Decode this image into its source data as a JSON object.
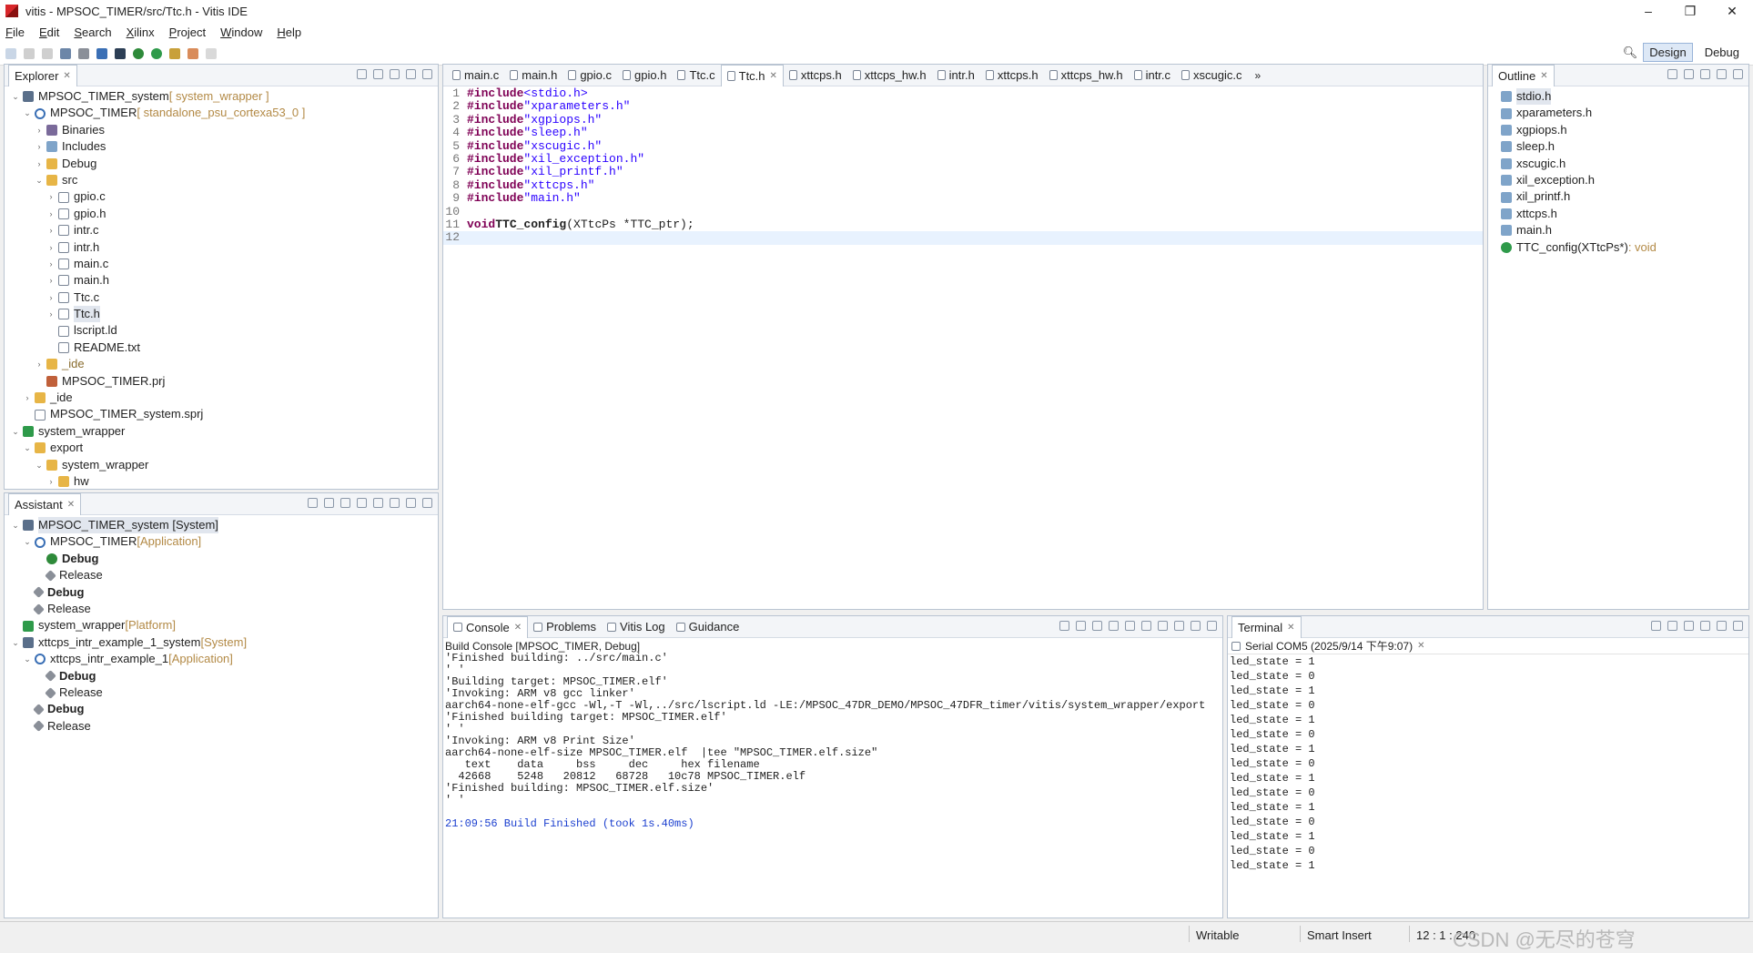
{
  "window": {
    "title": "vitis - MPSOC_TIMER/src/Ttc.h - Vitis IDE",
    "min": "–",
    "max": "❐",
    "close": "✕"
  },
  "menu": [
    "File",
    "Edit",
    "Search",
    "Xilinx",
    "Project",
    "Window",
    "Help"
  ],
  "perspectives": {
    "design": "Design",
    "debug": "Debug"
  },
  "explorer": {
    "tab": "Explorer",
    "rows": [
      {
        "text": "MPSOC_TIMER_system",
        "dec": " [ system_wrapper ]",
        "indent": 0,
        "tw": "⌄",
        "icon": "sys"
      },
      {
        "text": "MPSOC_TIMER",
        "dec": " [ standalone_psu_cortexa53_0 ]",
        "indent": 1,
        "tw": "⌄",
        "icon": "app"
      },
      {
        "text": "Binaries",
        "dec": "",
        "indent": 2,
        "tw": "›",
        "icon": "bin"
      },
      {
        "text": "Includes",
        "dec": "",
        "indent": 2,
        "tw": "›",
        "icon": "inc"
      },
      {
        "text": "Debug",
        "dec": "",
        "indent": 2,
        "tw": "›",
        "icon": "folder"
      },
      {
        "text": "src",
        "dec": "",
        "indent": 2,
        "tw": "⌄",
        "icon": "folder"
      },
      {
        "text": "gpio.c",
        "dec": "",
        "indent": 3,
        "tw": "›",
        "icon": "file"
      },
      {
        "text": "gpio.h",
        "dec": "",
        "indent": 3,
        "tw": "›",
        "icon": "file"
      },
      {
        "text": "intr.c",
        "dec": "",
        "indent": 3,
        "tw": "›",
        "icon": "file"
      },
      {
        "text": "intr.h",
        "dec": "",
        "indent": 3,
        "tw": "›",
        "icon": "file"
      },
      {
        "text": "main.c",
        "dec": "",
        "indent": 3,
        "tw": "›",
        "icon": "file"
      },
      {
        "text": "main.h",
        "dec": "",
        "indent": 3,
        "tw": "›",
        "icon": "file"
      },
      {
        "text": "Ttc.c",
        "dec": "",
        "indent": 3,
        "tw": "›",
        "icon": "file"
      },
      {
        "text": "Ttc.h",
        "dec": "",
        "indent": 3,
        "tw": "›",
        "icon": "file",
        "sel": true
      },
      {
        "text": "lscript.ld",
        "dec": "",
        "indent": 3,
        "tw": "",
        "icon": "file"
      },
      {
        "text": "README.txt",
        "dec": "",
        "indent": 3,
        "tw": "",
        "icon": "file"
      },
      {
        "text": "_ide",
        "dec": "",
        "indent": 2,
        "tw": "›",
        "icon": "folder",
        "dim": true
      },
      {
        "text": "MPSOC_TIMER.prj",
        "dec": "",
        "indent": 2,
        "tw": "",
        "icon": "cfg"
      },
      {
        "text": "_ide",
        "dec": "",
        "indent": 1,
        "tw": "›",
        "icon": "folder"
      },
      {
        "text": "MPSOC_TIMER_system.sprj",
        "dec": "",
        "indent": 1,
        "tw": "",
        "icon": "file"
      },
      {
        "text": "system_wrapper",
        "dec": "",
        "indent": 0,
        "tw": "⌄",
        "icon": "plat"
      },
      {
        "text": "export",
        "dec": "",
        "indent": 1,
        "tw": "⌄",
        "icon": "folder"
      },
      {
        "text": "system_wrapper",
        "dec": "",
        "indent": 2,
        "tw": "⌄",
        "icon": "folder"
      },
      {
        "text": "hw",
        "dec": "",
        "indent": 3,
        "tw": "›",
        "icon": "folder"
      }
    ]
  },
  "assistant": {
    "tab": "Assistant",
    "rows": [
      {
        "text": "MPSOC_TIMER_system [System]",
        "dec": "",
        "indent": 0,
        "tw": "⌄",
        "icon": "sys",
        "sel": true
      },
      {
        "text": "MPSOC_TIMER",
        "dec": " [Application]",
        "indent": 1,
        "tw": "⌄",
        "icon": "app"
      },
      {
        "text": "Debug",
        "dec": "",
        "indent": 2,
        "tw": "",
        "icon": "bug",
        "bold": true
      },
      {
        "text": "Release",
        "dec": "",
        "indent": 2,
        "tw": "",
        "icon": "hammer"
      },
      {
        "text": "Debug",
        "dec": "",
        "indent": 1,
        "tw": "",
        "icon": "hammer",
        "bold": true
      },
      {
        "text": "Release",
        "dec": "",
        "indent": 1,
        "tw": "",
        "icon": "hammer"
      },
      {
        "text": "system_wrapper",
        "dec": " [Platform]",
        "indent": 0,
        "tw": "",
        "icon": "plat"
      },
      {
        "text": "xttcps_intr_example_1_system",
        "dec": " [System]",
        "indent": 0,
        "tw": "⌄",
        "icon": "sys"
      },
      {
        "text": "xttcps_intr_example_1",
        "dec": " [Application]",
        "indent": 1,
        "tw": "⌄",
        "icon": "app"
      },
      {
        "text": "Debug",
        "dec": "",
        "indent": 2,
        "tw": "",
        "icon": "hammer",
        "bold": true
      },
      {
        "text": "Release",
        "dec": "",
        "indent": 2,
        "tw": "",
        "icon": "hammer"
      },
      {
        "text": "Debug",
        "dec": "",
        "indent": 1,
        "tw": "",
        "icon": "hammer",
        "bold": true
      },
      {
        "text": "Release",
        "dec": "",
        "indent": 1,
        "tw": "",
        "icon": "hammer"
      }
    ]
  },
  "editor": {
    "tabs": [
      "main.c",
      "main.h",
      "gpio.c",
      "gpio.h",
      "Ttc.c",
      "Ttc.h",
      "xttcps.h",
      "xttcps_hw.h",
      "intr.h",
      "xttcps.h",
      "xttcps_hw.h",
      "intr.c",
      "xscugic.c"
    ],
    "active_tab": 5,
    "overflow": "»",
    "includes": [
      "<stdio.h>",
      "\"xparameters.h\"",
      "\"xgpiops.h\"",
      "\"sleep.h\"",
      "\"xscugic.h\"",
      "\"xil_exception.h\"",
      "\"xil_printf.h\"",
      "\"xttcps.h\"",
      "\"main.h\""
    ],
    "include_kw": "#include",
    "decl": {
      "kw": "void",
      "fn": "TTC_config",
      "args": "(XTtcPs *TTC_ptr);"
    }
  },
  "outline": {
    "tab": "Outline",
    "items": [
      "stdio.h",
      "xparameters.h",
      "xgpiops.h",
      "sleep.h",
      "xscugic.h",
      "xil_exception.h",
      "xil_printf.h",
      "xttcps.h",
      "main.h"
    ],
    "func": "TTC_config(XTtcPs*)",
    "func_type": " : void"
  },
  "console": {
    "tabs": [
      "Console",
      "Problems",
      "Vitis Log",
      "Guidance"
    ],
    "header": "Build Console [MPSOC_TIMER, Debug]",
    "lines": [
      "'Finished building: ../src/main.c'",
      "' '",
      "'Building target: MPSOC_TIMER.elf'",
      "'Invoking: ARM v8 gcc linker'",
      "aarch64-none-elf-gcc -Wl,-T -Wl,../src/lscript.ld -LE:/MPSOC_47DR_DEMO/MPSOC_47DFR_timer/vitis/system_wrapper/export",
      "'Finished building target: MPSOC_TIMER.elf'",
      "' '",
      "'Invoking: ARM v8 Print Size'",
      "aarch64-none-elf-size MPSOC_TIMER.elf  |tee \"MPSOC_TIMER.elf.size\"",
      "   text    data     bss     dec     hex filename",
      "  42668    5248   20812   68728   10c78 MPSOC_TIMER.elf",
      "'Finished building: MPSOC_TIMER.elf.size'",
      "' '",
      "",
      "21:09:56 Build Finished (took 1s.40ms)"
    ]
  },
  "terminal": {
    "tab": "Terminal",
    "session": "Serial COM5 (2025/9/14 下午9:07)",
    "lines": [
      "led_state = 1",
      "led_state = 0",
      "led_state = 1",
      "led_state = 0",
      "led_state = 1",
      "led_state = 0",
      "led_state = 1",
      "led_state = 0",
      "led_state = 1",
      "led_state = 0",
      "led_state = 1",
      "led_state = 0",
      "led_state = 1",
      "led_state = 0",
      "led_state = 1"
    ]
  },
  "status": {
    "writable": "Writable",
    "insert": "Smart Insert",
    "pos": "12 : 1 : 240"
  },
  "watermark": "CSDN @无尽的苍穹",
  "colors": {
    "accent": "#3a6fb5",
    "keyword": "#7f0055",
    "string": "#2a00ff",
    "decoration": "#b38a46",
    "build_finished": "#1b3fcf"
  }
}
